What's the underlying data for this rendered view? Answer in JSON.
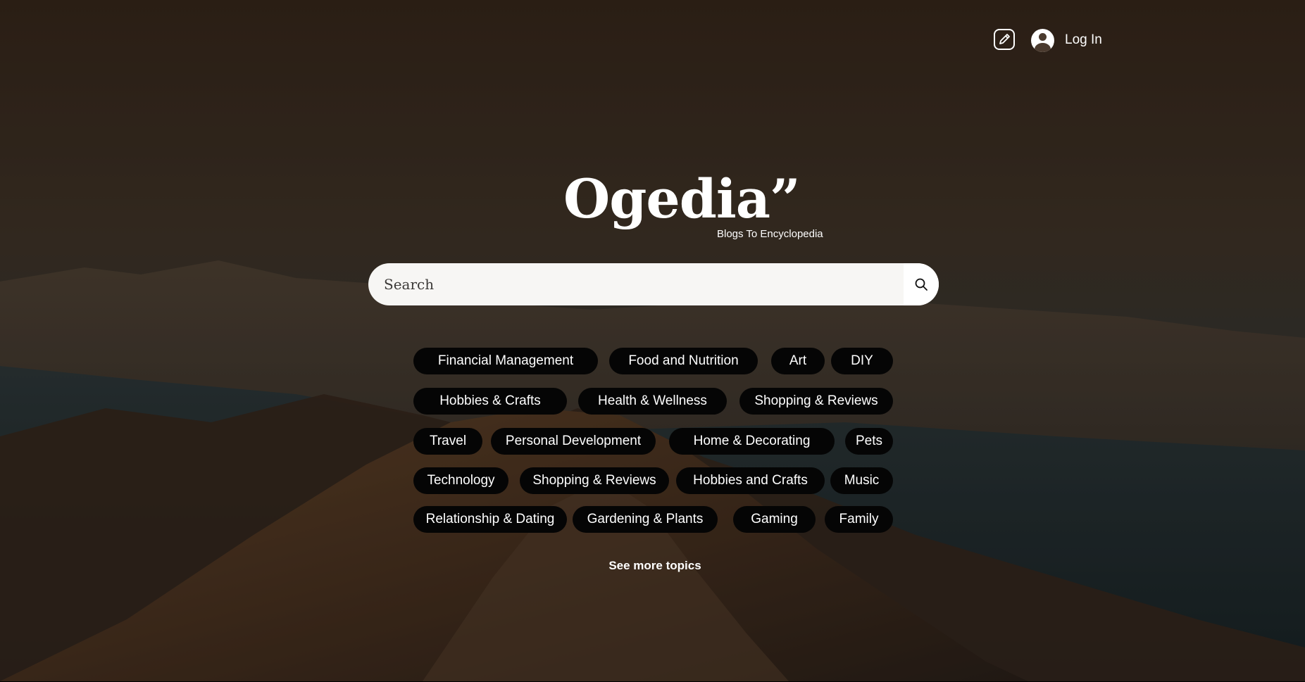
{
  "header": {
    "login_label": "Log In"
  },
  "brand": {
    "name": "Ogedia”",
    "tagline": "Blogs To Encyclopedia"
  },
  "search": {
    "placeholder": "Search"
  },
  "topics": {
    "rows": [
      [
        "Financial Management",
        "Food and Nutrition",
        "Art",
        "DIY"
      ],
      [
        "Hobbies & Crafts",
        "Health & Wellness",
        "Shopping & Reviews"
      ],
      [
        "Travel",
        "Personal Development",
        "Home & Decorating",
        "Pets"
      ],
      [
        "Technology",
        "Shopping & Reviews",
        "Hobbies and Crafts",
        "Music"
      ],
      [
        "Relationship & Dating",
        "Gardening & Plants",
        "Gaming",
        "Family"
      ]
    ],
    "see_more_label": "See more topics"
  },
  "icons": {
    "edit": "edit-pencil-icon",
    "user": "user-avatar-icon",
    "search": "magnifier-icon"
  },
  "colors": {
    "chip_background": "#050505",
    "search_background": "#f7f6f4",
    "text": "#ffffff"
  }
}
